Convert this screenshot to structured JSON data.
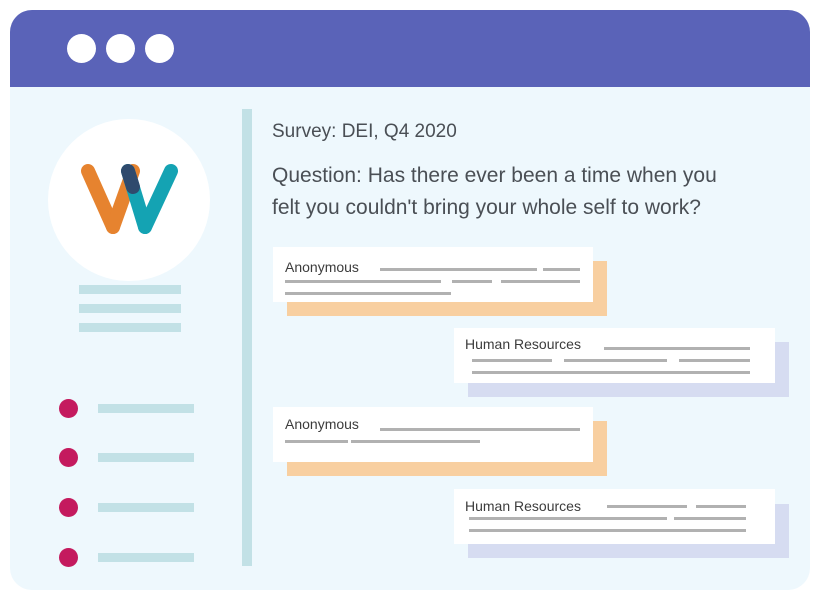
{
  "colors": {
    "titlebar": "#5a63b8",
    "window_bg": "#eef8fd",
    "divider": "#c2e1e6",
    "bullet": "#c41a5e",
    "anonymous_accent": "#f8cfa0",
    "hr_accent": "#d6dcf1",
    "logo_orange": "#e6832f",
    "logo_teal": "#14a3b3"
  },
  "window": {
    "dots": [
      "window-dot",
      "window-dot",
      "window-dot"
    ]
  },
  "logo": {
    "icon": "w-logo-icon"
  },
  "main": {
    "survey_title": "Survey: DEI, Q4 2020",
    "question_line1": "Question: Has there ever been a time when you",
    "question_line2": "felt you couldn't bring your whole self to work?"
  },
  "responses": [
    {
      "author": "Anonymous"
    },
    {
      "author": "Human Resources"
    },
    {
      "author": "Anonymous"
    },
    {
      "author": "Human Resources"
    }
  ]
}
